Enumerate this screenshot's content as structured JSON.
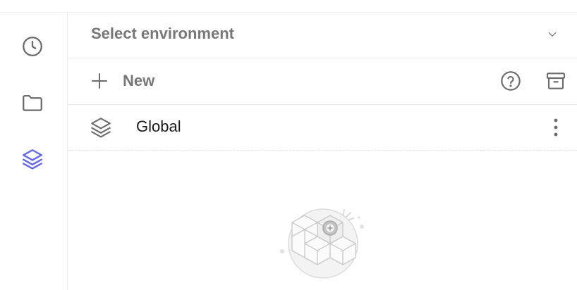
{
  "rail": {
    "items": [
      {
        "name": "history",
        "icon": "clock-icon",
        "active": false
      },
      {
        "name": "collections",
        "icon": "folder-icon",
        "active": false
      },
      {
        "name": "environments",
        "icon": "layers-icon",
        "active": true
      }
    ]
  },
  "environment_select": {
    "label": "Select environment",
    "icon": "chevron-down-icon"
  },
  "toolbar": {
    "new_label": "New",
    "help_icon": "help-circle-icon",
    "archive_icon": "archive-icon"
  },
  "environments": [
    {
      "label": "Global",
      "icon": "layers-icon",
      "menu_icon": "more-vertical-icon"
    }
  ],
  "empty_state": {
    "icon": "blocks-illustration"
  },
  "colors": {
    "accent": "#6366f1",
    "text_muted": "#777777",
    "icon_gray": "#6b6b6b",
    "border": "#ececec"
  }
}
